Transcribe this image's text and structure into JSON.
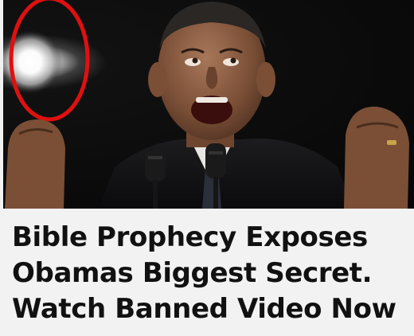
{
  "ad": {
    "image_alt": "Man speaking at a microphone with a bright circled orb of light",
    "headline_lines": [
      "Bible Prophecy Exposes",
      "Obamas Biggest Secret.",
      "Watch Banned Video Now"
    ]
  },
  "colors": {
    "highlight_circle": "#e01010",
    "headline_text": "#111111",
    "background": "#f2f2f2"
  }
}
